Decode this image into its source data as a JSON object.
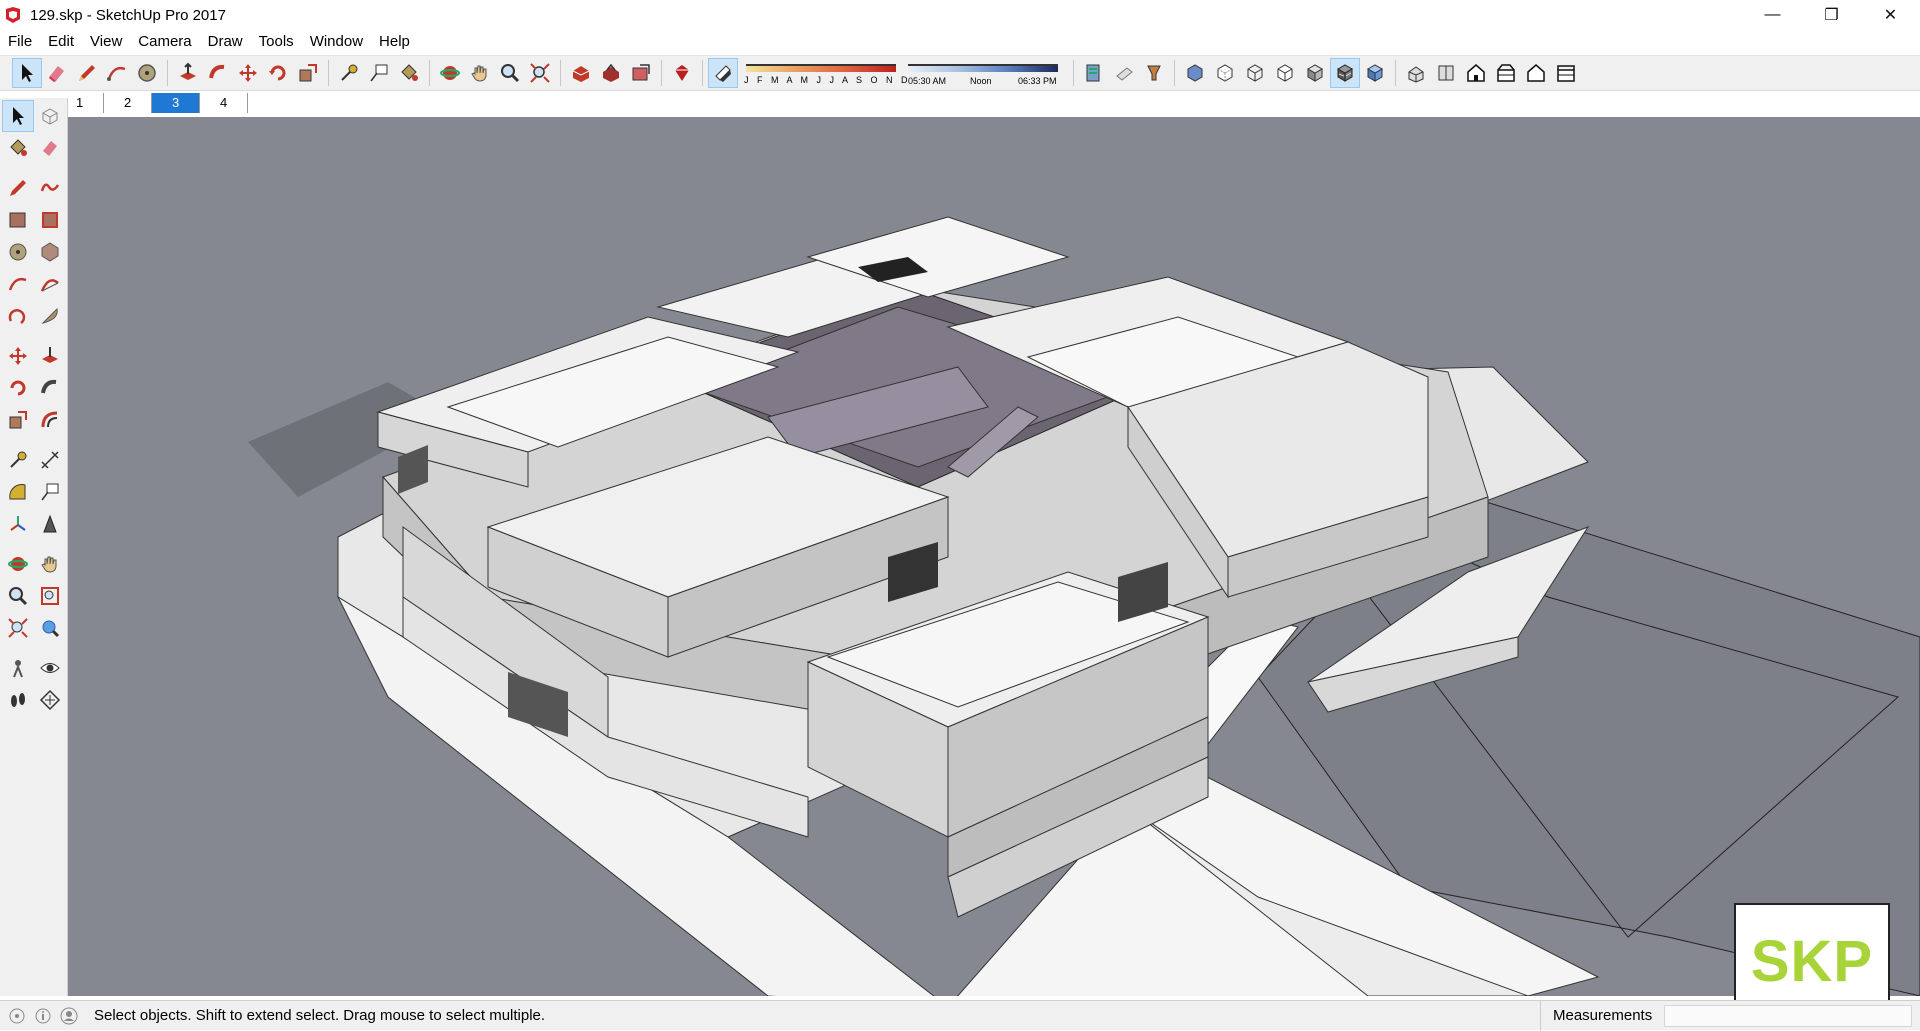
{
  "window": {
    "title": "129.skp - SketchUp Pro 2017",
    "minimize": "—",
    "restore": "❐",
    "close": "✕"
  },
  "menu": [
    "File",
    "Edit",
    "View",
    "Camera",
    "Draw",
    "Tools",
    "Window",
    "Help"
  ],
  "shadow": {
    "months": "J F M A M J J A S O N D",
    "time_start": "05:30 AM",
    "time_mid": "Noon",
    "time_end": "06:33 PM"
  },
  "scenes": [
    {
      "label": "1",
      "active": false
    },
    {
      "label": "2",
      "active": false
    },
    {
      "label": "3",
      "active": true
    },
    {
      "label": "4",
      "active": false
    }
  ],
  "status": {
    "hint": "Select objects. Shift to extend select. Drag mouse to select multiple.",
    "measurements_label": "Measurements",
    "measurements_value": ""
  },
  "logo": {
    "text": "SKP",
    "color": "#a8d43a"
  },
  "colors": {
    "viewport_bg": "#858890",
    "active_tab": "#1e78d4"
  }
}
